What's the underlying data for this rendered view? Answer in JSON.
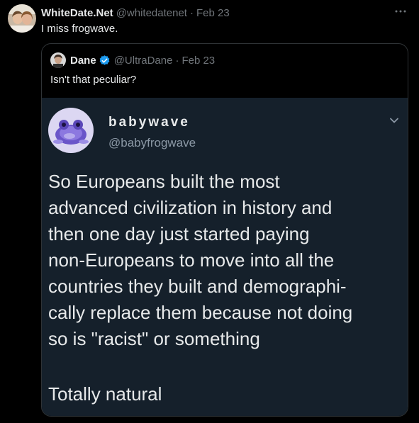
{
  "tweet": {
    "author_name": "WhiteDate.Net",
    "author_handle": "@whitedatenet",
    "separator": "·",
    "date": "Feb 23",
    "text": "I miss frogwave.",
    "more_icon": "more-horizontal-icon"
  },
  "quoted_tweet": {
    "author_name": "Dane",
    "author_handle": "@UltraDane",
    "separator": "·",
    "date": "Feb 23",
    "text": "Isn't that peculiar?",
    "verified_icon": "verified-badge-icon",
    "verified_color": "#1d9bf0"
  },
  "screenshot": {
    "author_name": "babywave",
    "author_handle": "@babyfrogwave",
    "body": "So Europeans built the most\nadvanced civilization in history and\nthen one day just started paying\nnon-Europeans to move into all the\ncountries they built and demographi-\ncally replace them because not doing\nso is \"racist\" or something",
    "closing": "Totally natural",
    "chevron_icon": "chevron-down-icon",
    "background": "#15202b"
  }
}
